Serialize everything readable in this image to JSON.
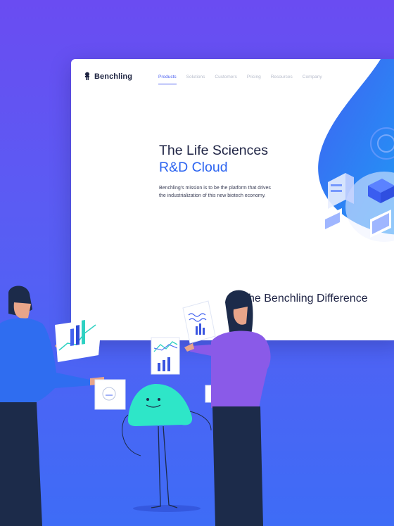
{
  "brand": {
    "name": "Benchling"
  },
  "nav": {
    "items": [
      {
        "label": "Products",
        "active": true
      },
      {
        "label": "Solutions",
        "active": false
      },
      {
        "label": "Customers",
        "active": false
      },
      {
        "label": "Pricing",
        "active": false
      },
      {
        "label": "Resources",
        "active": false
      },
      {
        "label": "Company",
        "active": false
      }
    ]
  },
  "hero": {
    "title_line1": "The Life Sciences",
    "title_line2": "R&D Cloud",
    "description": "Benchling's mission is to be the platform that drives the industrialization of this new biotech economy."
  },
  "section": {
    "heading": "he Benchling Difference"
  },
  "colors": {
    "accent": "#2b63f0",
    "nav_active": "#4f63f0",
    "background_top": "#6a4cf2",
    "background_bottom": "#3e6cf6",
    "mascot": "#2ee6c8",
    "person_shirt_left": "#2f6df0",
    "person_shirt_right": "#8a5ae8",
    "dark_navy": "#1c2b4a"
  }
}
